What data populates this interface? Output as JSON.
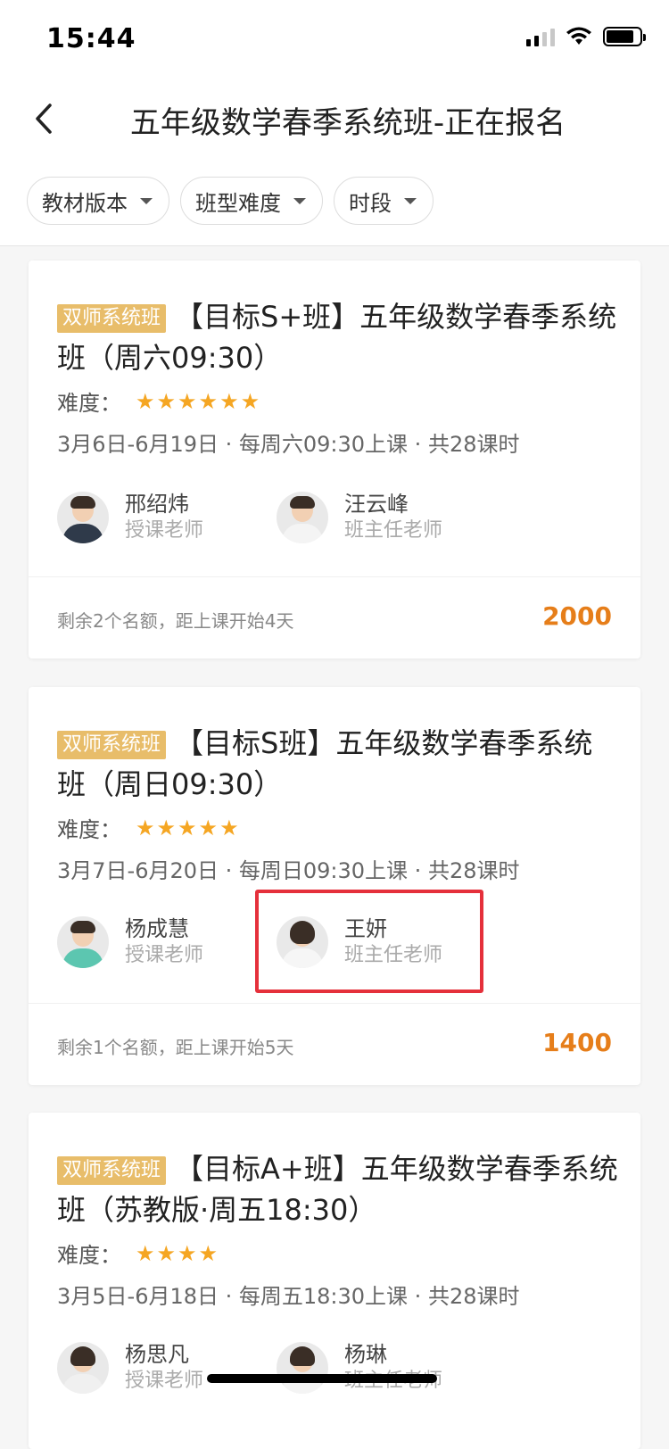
{
  "status": {
    "time": "15:44"
  },
  "nav": {
    "title": "五年级数学春季系统班-正在报名"
  },
  "filters": [
    {
      "label": "教材版本"
    },
    {
      "label": "班型难度"
    },
    {
      "label": "时段"
    }
  ],
  "colors": {
    "accent": "#e67e1a",
    "badge": "#e8bd6a",
    "star": "#f5a623",
    "highlight": "#e5303b"
  },
  "courses": [
    {
      "badge": "双师系统班",
      "title": "【目标S+班】五年级数学春季系统班（周六09:30）",
      "difficulty_label": "难度：",
      "stars": 6,
      "schedule": "3月6日-6月19日 · 每周六09:30上课 · 共28课时",
      "teachers": [
        {
          "name": "邢绍炜",
          "role": "授课老师"
        },
        {
          "name": "汪云峰",
          "role": "班主任老师"
        }
      ],
      "remain": "剩余2个名额，距上课开始4天",
      "price": "2000"
    },
    {
      "badge": "双师系统班",
      "title": "【目标S班】五年级数学春季系统班（周日09:30）",
      "difficulty_label": "难度：",
      "stars": 5,
      "schedule": "3月7日-6月20日 · 每周日09:30上课 · 共28课时",
      "teachers": [
        {
          "name": "杨成慧",
          "role": "授课老师"
        },
        {
          "name": "王妍",
          "role": "班主任老师"
        }
      ],
      "remain": "剩余1个名额，距上课开始5天",
      "price": "1400"
    },
    {
      "badge": "双师系统班",
      "title": "【目标A+班】五年级数学春季系统班（苏教版·周五18:30）",
      "difficulty_label": "难度：",
      "stars": 4,
      "schedule": "3月5日-6月18日 · 每周五18:30上课 · 共28课时",
      "teachers": [
        {
          "name": "杨思凡",
          "role": "授课老师"
        },
        {
          "name": "杨琳",
          "role": "班主任老师"
        }
      ]
    }
  ]
}
